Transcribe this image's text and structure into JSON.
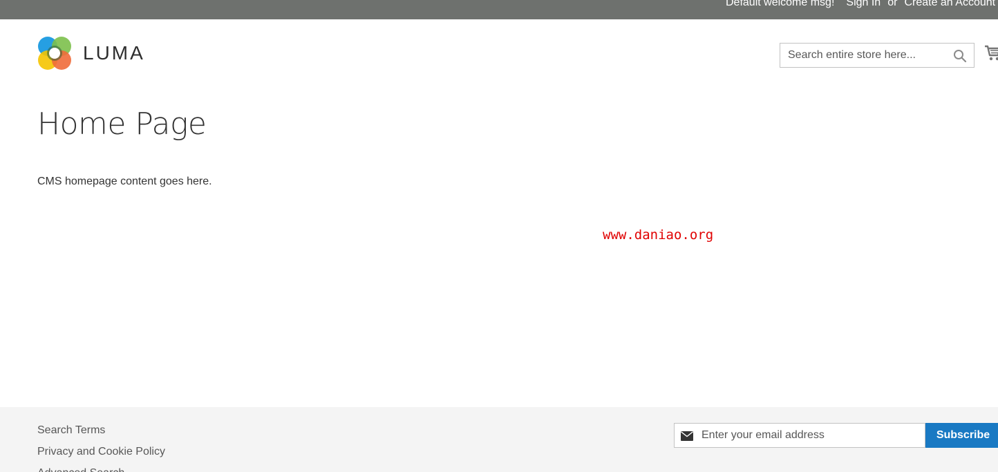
{
  "top_panel": {
    "welcome": "Default welcome msg!",
    "sign_in": "Sign In",
    "or": "or",
    "create_account": "Create an Account"
  },
  "header": {
    "logo_text": "LUMA",
    "search": {
      "placeholder": "Search entire store here...",
      "value": ""
    },
    "icons": {
      "search": "search-icon",
      "cart": "cart-icon"
    }
  },
  "main": {
    "page_title": "Home Page",
    "content": "CMS homepage content goes here.",
    "watermark": "www.daniao.org"
  },
  "footer": {
    "links": [
      "Search Terms",
      "Privacy and Cookie Policy",
      "Advanced Search"
    ],
    "newsletter": {
      "placeholder": "Enter your email address",
      "value": "",
      "button_label": "Subscribe",
      "icon": "mail-icon"
    }
  },
  "colors": {
    "top_panel_bg": "#6e716e",
    "subscribe_bg": "#1979c3",
    "footer_bg": "#f4f4f4",
    "watermark": "#e00000"
  }
}
